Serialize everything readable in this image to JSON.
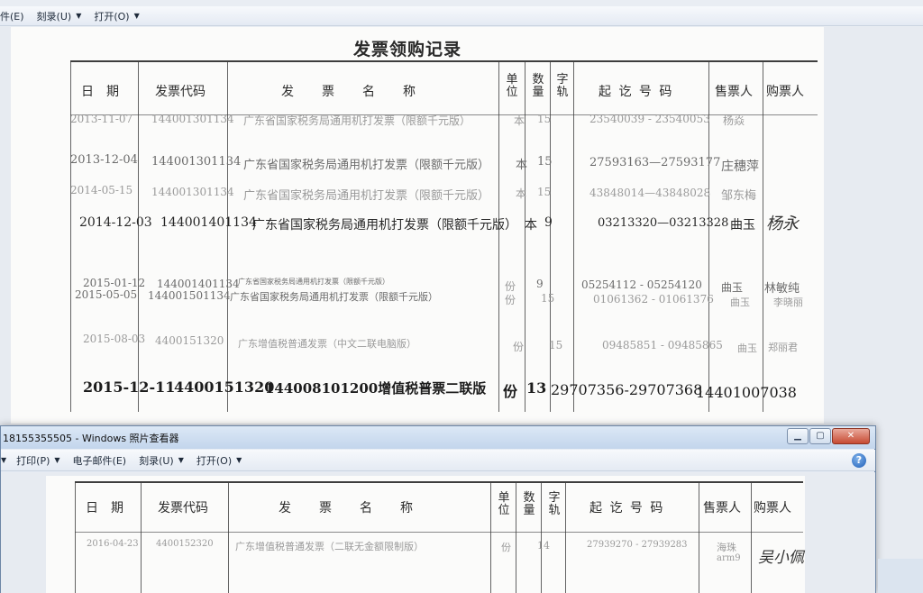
{
  "back_window": {
    "toolbar": [
      {
        "label": "件(E)",
        "dropdown": false
      },
      {
        "label": "刻录(U)",
        "dropdown": true
      },
      {
        "label": "打开(O)",
        "dropdown": true
      }
    ]
  },
  "document": {
    "title": "发票领购记录",
    "headers": {
      "date": "日　期",
      "code": "发票代码",
      "name": "发　　票　　名　　称",
      "unit": "单位",
      "qty": "数量",
      "track": "字轨",
      "range": "起 讫 号 码",
      "seller": "售票人",
      "buyer": "购票人"
    },
    "rows": [
      {
        "date": "2013-11-07",
        "code": "144001301134",
        "name": "广东省国家税务局通用机打发票（限额千元版）",
        "unit": "本",
        "qty": "15",
        "range": "23540039 - 23540053",
        "seller": "杨焱",
        "buyer": ""
      },
      {
        "date": "2013-12-04",
        "code": "144001301134",
        "name": "广东省国家税务局通用机打发票（限额千元版）",
        "unit": "本",
        "qty": "15",
        "range": "27593163—27593177",
        "seller": "庄穗萍",
        "buyer": ""
      },
      {
        "date": "2014-05-15",
        "code": "144001301134",
        "name": "广东省国家税务局通用机打发票（限额千元版）",
        "unit": "本",
        "qty": "15",
        "range": "43848014—43848028",
        "seller": "邹东梅",
        "buyer": ""
      },
      {
        "date": "2014-12-03",
        "code": "144001401134",
        "name": "广东省国家税务局通用机打发票（限额千元版）",
        "unit": "本",
        "qty": "9",
        "range": "03213320—03213328",
        "seller": "曲玉",
        "buyer": "杨永"
      },
      {
        "date": "2015-01-12",
        "code": "144001401134",
        "name": "广东省国家税务局通用机打发票（限额千元版）",
        "unit": "份",
        "qty": "9",
        "range": "05254112 - 05254120",
        "seller": "曲玉",
        "buyer": "林敏纯"
      },
      {
        "date": "2015-05-05",
        "code": "144001501134",
        "name": "广东省国家税务局通用机打发票（限额千元版）",
        "unit": "份",
        "qty": "15",
        "range": "01061362 - 01061376",
        "seller": "曲玉",
        "buyer": "李晓丽"
      },
      {
        "date": "2015-08-03",
        "code": "4400151320",
        "name": "广东增值税普通发票（中文二联电脑版）",
        "unit": "份",
        "qty": "15",
        "range": "09485851 - 09485865",
        "seller": "曲玉",
        "buyer": "郑丽君"
      },
      {
        "date": "2015-12-11",
        "code": "4400151320",
        "name": "144008101200增值税普票二联版",
        "unit": "份",
        "qty": "13",
        "range": "29707356-29707368",
        "seller": "14401007038",
        "buyer": ""
      }
    ]
  },
  "front_window": {
    "title": "18155355505 - Windows 照片查看器",
    "toolbar": [
      {
        "label": "打印(P)",
        "dropdown": true
      },
      {
        "label": "电子邮件(E)",
        "dropdown": false
      },
      {
        "label": "刻录(U)",
        "dropdown": true
      },
      {
        "label": "打开(O)",
        "dropdown": true
      }
    ],
    "row": {
      "date": "2016-04-23",
      "code": "4400152320",
      "name": "广东增值税普通发票（二联无金额限制版）",
      "unit": "份",
      "qty": "14",
      "range": "27939270 - 27939283",
      "seller": "海珠",
      "seller2": "arm9",
      "buyer": "吴小佩"
    }
  }
}
